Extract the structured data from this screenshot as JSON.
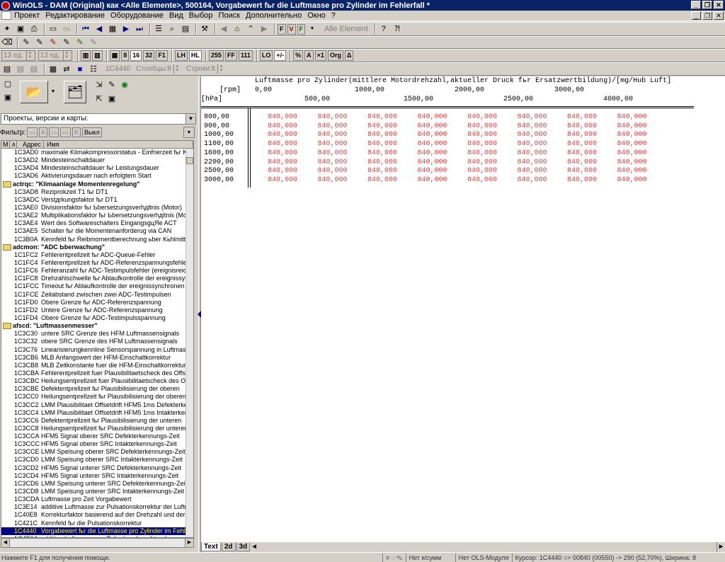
{
  "window": {
    "title": "WinOLS - DAM (Original) как <Alle Elemente>, 500164, Vorgabewert fьr die Luftmasse pro Zylinder im Fehlerfall *"
  },
  "menu": [
    "Проект",
    "Редактирование",
    "Оборудование",
    "Вид",
    "Выбор",
    "Поиск",
    "Дополнительно",
    "Окно",
    "?"
  ],
  "toolbar": {
    "element_label": "Alle Element",
    "spin1": "13 ед.",
    "spin2": "13 ед.",
    "address": "1C4440",
    "cols": "Столбцы:8",
    "rows": "Строки:8"
  },
  "project_combo": "Проекты, версии и карты:",
  "filter": {
    "label": "Фильтр:",
    "off_label": "Выкл"
  },
  "list": {
    "head": {
      "m": "M",
      "a": "Адрес",
      "n": "Имя"
    },
    "rows": [
      {
        "a": "1C3AD0",
        "n": "maximale Klimakompressorstatus - Einfrierzeit fьr Klimakompressor"
      },
      {
        "a": "1C3AD2",
        "n": "Mindesteinschaltdauer"
      },
      {
        "a": "1C3AD4",
        "n": "Mindesteinschaltdauer fьr Leistungsdauer"
      },
      {
        "a": "1C3AD6",
        "n": "Aktivierungsdauer nach erfolgtem Start"
      },
      {
        "f": true,
        "n": "actrqc: \"Klimaanlage Momentenregelung\""
      },
      {
        "a": "1C3AD8",
        "n": "Reziprokzeit T1 fьr DT1"
      },
      {
        "a": "1C3ADC",
        "n": "Verstдrkungsfaktor fьr DT1"
      },
      {
        "a": "1C3AE0",
        "n": "Divisionsfaktor fьr Ьbersetzungsverhдltnis (Motor)"
      },
      {
        "a": "1C3AE2",
        "n": "Multiplikationsfaktor fьr Ьbersetzungsverhдltnis (Motor)"
      },
      {
        "a": "1C3AE4",
        "n": "Wert des Softwareschalters EingangsgцЯe ACT"
      },
      {
        "a": "1C3AE5",
        "n": "Schalter fьr die Momentenanforderug via CAN"
      },
      {
        "a": "1C3B0A",
        "n": "Kennfeld fьr Reibmomentberechnung ьber Kьhlmittel"
      },
      {
        "f": true,
        "n": "adcmon: \"ADC Ьberwachung\""
      },
      {
        "a": "1C1FC2",
        "n": "Fehlerentprellzeit fьr ADC-Queue-Fehler"
      },
      {
        "a": "1C1FC4",
        "n": "Fehlerentprellzeit fьr ADC-Referenzspannungsfehler"
      },
      {
        "a": "1C1FC6",
        "n": "Fehleranzahl fьr ADC-Testimpulsfehler (ereignisreich)"
      },
      {
        "a": "1C1FC8",
        "n": "Drehzahlschwelle fьr Ablaufkontrolle der ereignissynchronen"
      },
      {
        "a": "1C1FCC",
        "n": "Timeout fьr Ablaufkontrolle der ereignissynchronen"
      },
      {
        "a": "1C1FCE",
        "n": "Zeitabstand zwischen zwei ADC-Testimpulsen"
      },
      {
        "a": "1C1FD0",
        "n": "Obere Grenze fьr ADC-Referenzspannung"
      },
      {
        "a": "1C1FD2",
        "n": "Untere Grenze fьr ADC-Referenzspannung"
      },
      {
        "a": "1C1FD4",
        "n": "Obere Grenze fьr ADC-Testimpulsspannung"
      },
      {
        "f": true,
        "n": "afscd: \"Luftmassenmesser\""
      },
      {
        "a": "1C3C30",
        "n": "untere SRC Grenze des HFM Luftmassensignals"
      },
      {
        "a": "1C3C32",
        "n": "obere SRC Grenze des HFM Luftmassensignals"
      },
      {
        "a": "1C3C76",
        "n": "Linearisierungkennline Sensorspannung in Luftmasse"
      },
      {
        "a": "1C3CB6",
        "n": "MLB Anfangswert der HFM-Einschaltkorrektur"
      },
      {
        "a": "1C3CB8",
        "n": "MLB Zeitkonstante fuer die HFM-Einschaltkorrektur"
      },
      {
        "a": "1C3CBA",
        "n": "Fehlerentprellzeit fuer Plausibilitaetscheck des Offsetdrift"
      },
      {
        "a": "1C3CBC",
        "n": "Heilungsentprellzeit fuer Plausibilitaetscheck des Offsetdrift"
      },
      {
        "a": "1C3CBE",
        "n": "Defektentprellzeit fьr Plausibilisierung der oberen"
      },
      {
        "a": "1C3CC0",
        "n": "Heilungsentprellzeit fьr Plausibilisierung der oberen"
      },
      {
        "a": "1C3CC2",
        "n": "LMM Plausibilitaet Offsetdrift HFM5 1ms Defekterkennung"
      },
      {
        "a": "1C3CC4",
        "n": "LMM Plausibilitaet Offsetdrift HFM5 1ms Intakterkennung"
      },
      {
        "a": "1C3CC6",
        "n": "Defektentprellzeit fьr Plausibilisierung der unteren"
      },
      {
        "a": "1C3CC8",
        "n": "Heilungsentprellzeit fьr Plausibilisierung der unteren"
      },
      {
        "a": "1C3CCA",
        "n": "HFM5 Signal oberer SRC Defekterkennungs-Zeit"
      },
      {
        "a": "1C3CCC",
        "n": "HFM5 Signal oberer SRC Intakterkennungs-Zeit"
      },
      {
        "a": "1C3CCE",
        "n": "LMM  Speisung oberer  SRC  Defekterkennungs-Zeit"
      },
      {
        "a": "1C3CD0",
        "n": "LMM  Speisung oberer  SRC  Intakterkennungs-Zeit"
      },
      {
        "a": "1C3CD2",
        "n": "HFM5 Signal unterer SRC Defekterkennungs-Zeit"
      },
      {
        "a": "1C3CD4",
        "n": "HFM5 Signal unterer SRC Intakterkennungs-Zeit"
      },
      {
        "a": "1C3CD6",
        "n": "LMM  Speisung unterer SRC  Defekterkennungs-Zeit"
      },
      {
        "a": "1C3CD8",
        "n": "LMM  Speisung unterer SRC  Intakterkennungs-Zeit"
      },
      {
        "a": "1C3CDA",
        "n": "Luftmasse pro Zeit Vorgabewert"
      },
      {
        "a": "1C3E14",
        "n": "additive Luftmasse zur Pulsationskorrektur der Luftmasse"
      },
      {
        "a": "1C40E8",
        "n": "Korrekturfaktor basierend auf der Drehzahl und der"
      },
      {
        "a": "1C421C",
        "n": "Kennfeld fьr die Pulsationskorrektur"
      },
      {
        "a": "1C4440",
        "n": "Vorgabewert fьr die Luftmasse pro Zylinder im Fehlerfall",
        "s": true
      },
      {
        "a": "1C4E04",
        "n": "additive Luftmasse zur Pulsationskorrektur der"
      }
    ]
  },
  "map": {
    "title": "Luftmasse pro Zylinder(mittlere Motordrehzahl,aktueller Druck fьr Ersatzwertbildung)/[mg/Hub Luft]",
    "x_unit": "[rpm]",
    "y_unit": "[hPa]",
    "x_top": [
      "0,00",
      "1000,00",
      "2000,00",
      "3000,00"
    ],
    "x_bottom": [
      "500,00",
      "1500,00",
      "2500,00",
      "4000,00"
    ],
    "y": [
      "800,00",
      "900,00",
      "1000,00",
      "1100,00",
      "1600,00",
      "2200,00",
      "2500,00",
      "3000,00"
    ],
    "value": "840,000"
  },
  "tabs": [
    "Text",
    "2d",
    "3d"
  ],
  "status": {
    "hint": "Нажмите F1 для получения помощи.",
    "chk": "Нет к/сумм",
    "ols": "Нет OLS-Модуля",
    "cursor": "Курсор: 1C4440 => 00840 (00550) -> 290 (52,70%), Ширина: 8"
  }
}
